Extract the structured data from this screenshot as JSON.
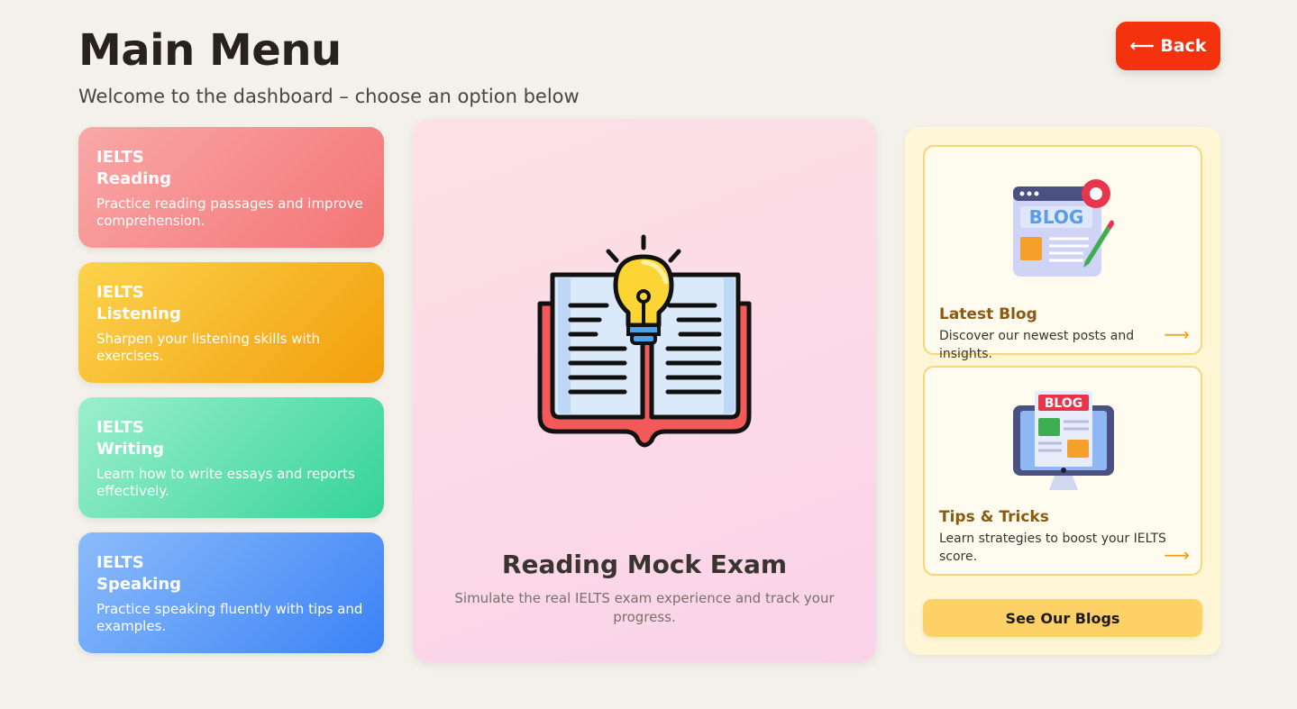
{
  "header": {
    "title": "Main Menu",
    "subtitle": "Welcome to the dashboard – choose an option below",
    "back_label": "⟵ Back"
  },
  "modules": [
    {
      "line1": "IELTS",
      "line2": "Reading",
      "description": "Practice reading passages and improve comprehension."
    },
    {
      "line1": "IELTS",
      "line2": "Listening",
      "description": "Sharpen your listening skills with exercises."
    },
    {
      "line1": "IELTS",
      "line2": "Writing",
      "description": "Learn how to write essays and reports effectively."
    },
    {
      "line1": "IELTS",
      "line2": "Speaking",
      "description": "Practice speaking fluently with tips and examples."
    }
  ],
  "featured": {
    "title": "Reading Mock Exam",
    "description": "Simulate the real IELTS exam experience and track your progress.",
    "icon": "book-lightbulb-icon"
  },
  "blog_panel": {
    "cards": [
      {
        "title": "Latest Blog",
        "description": "Discover our newest posts and insights.",
        "arrow": "⟶",
        "icon": "blog-settings-icon",
        "icon_text": "BLOG"
      },
      {
        "title": "Tips & Tricks",
        "description": "Learn strategies to boost your IELTS score.",
        "arrow": "⟶",
        "icon": "blog-monitor-icon",
        "icon_text": "BLOG"
      }
    ],
    "button_label": "See Our Blogs"
  },
  "colors": {
    "background": "#f4f1ea",
    "back_button": "#f4320e",
    "reading": "#f47474",
    "listening": "#f29e0b",
    "writing": "#34d399",
    "speaking": "#3b82f6",
    "blog_panel": "#fff6d6",
    "blog_button": "#fed166"
  }
}
